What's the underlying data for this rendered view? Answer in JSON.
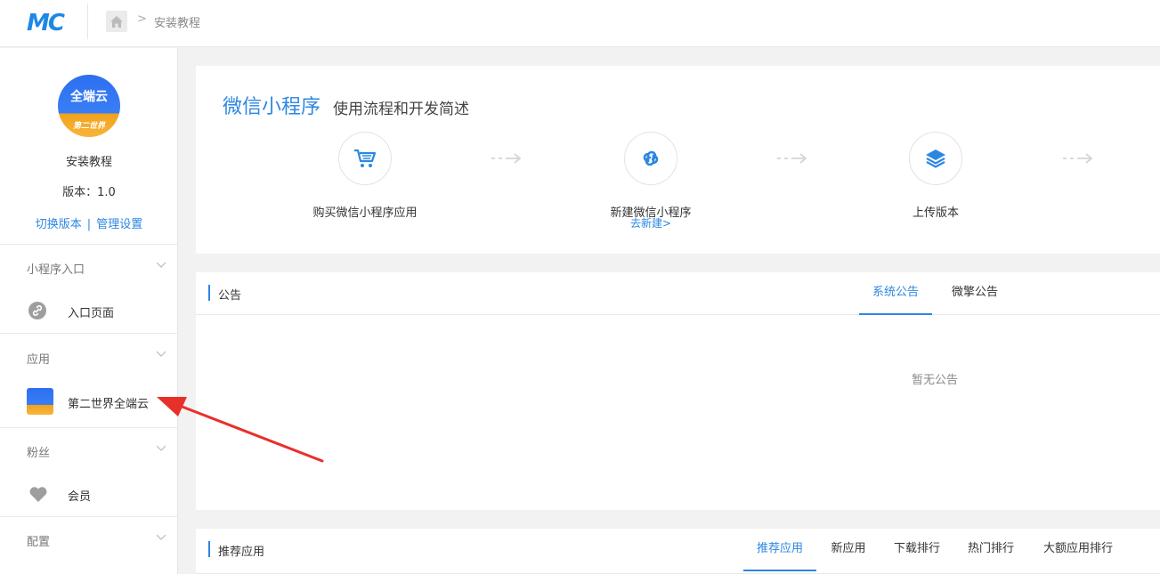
{
  "header": {
    "logo": "MC",
    "breadcrumb": "安装教程"
  },
  "sidebar": {
    "avatar_title": "全端云",
    "avatar_sub": "第二世界",
    "app_name": "安装教程",
    "version": "版本：1.0",
    "switch_version": "切换版本",
    "link_separator": "|",
    "manage_settings": "管理设置",
    "sections": [
      {
        "title": "小程序入口",
        "item": "入口页面"
      },
      {
        "title": "应用",
        "item": "第二世界全端云"
      },
      {
        "title": "粉丝",
        "item": "会员"
      },
      {
        "title": "配置"
      }
    ]
  },
  "flow": {
    "title_main": "微信小程序",
    "title_sub": "使用流程和开发简述",
    "steps": [
      {
        "label": "购买微信小程序应用"
      },
      {
        "label": "新建微信小程序",
        "link": "去新建>"
      },
      {
        "label": "上传版本"
      }
    ]
  },
  "notice": {
    "title": "公告",
    "tabs": [
      "系统公告",
      "微擎公告"
    ],
    "empty": "暂无公告"
  },
  "recommend": {
    "title": "推荐应用",
    "tabs": [
      "推荐应用",
      "新应用",
      "下载排行",
      "热门排行",
      "大额应用排行"
    ]
  },
  "colors": {
    "accent": "#2d87e2",
    "annotation_arrow": "#e8302a"
  }
}
